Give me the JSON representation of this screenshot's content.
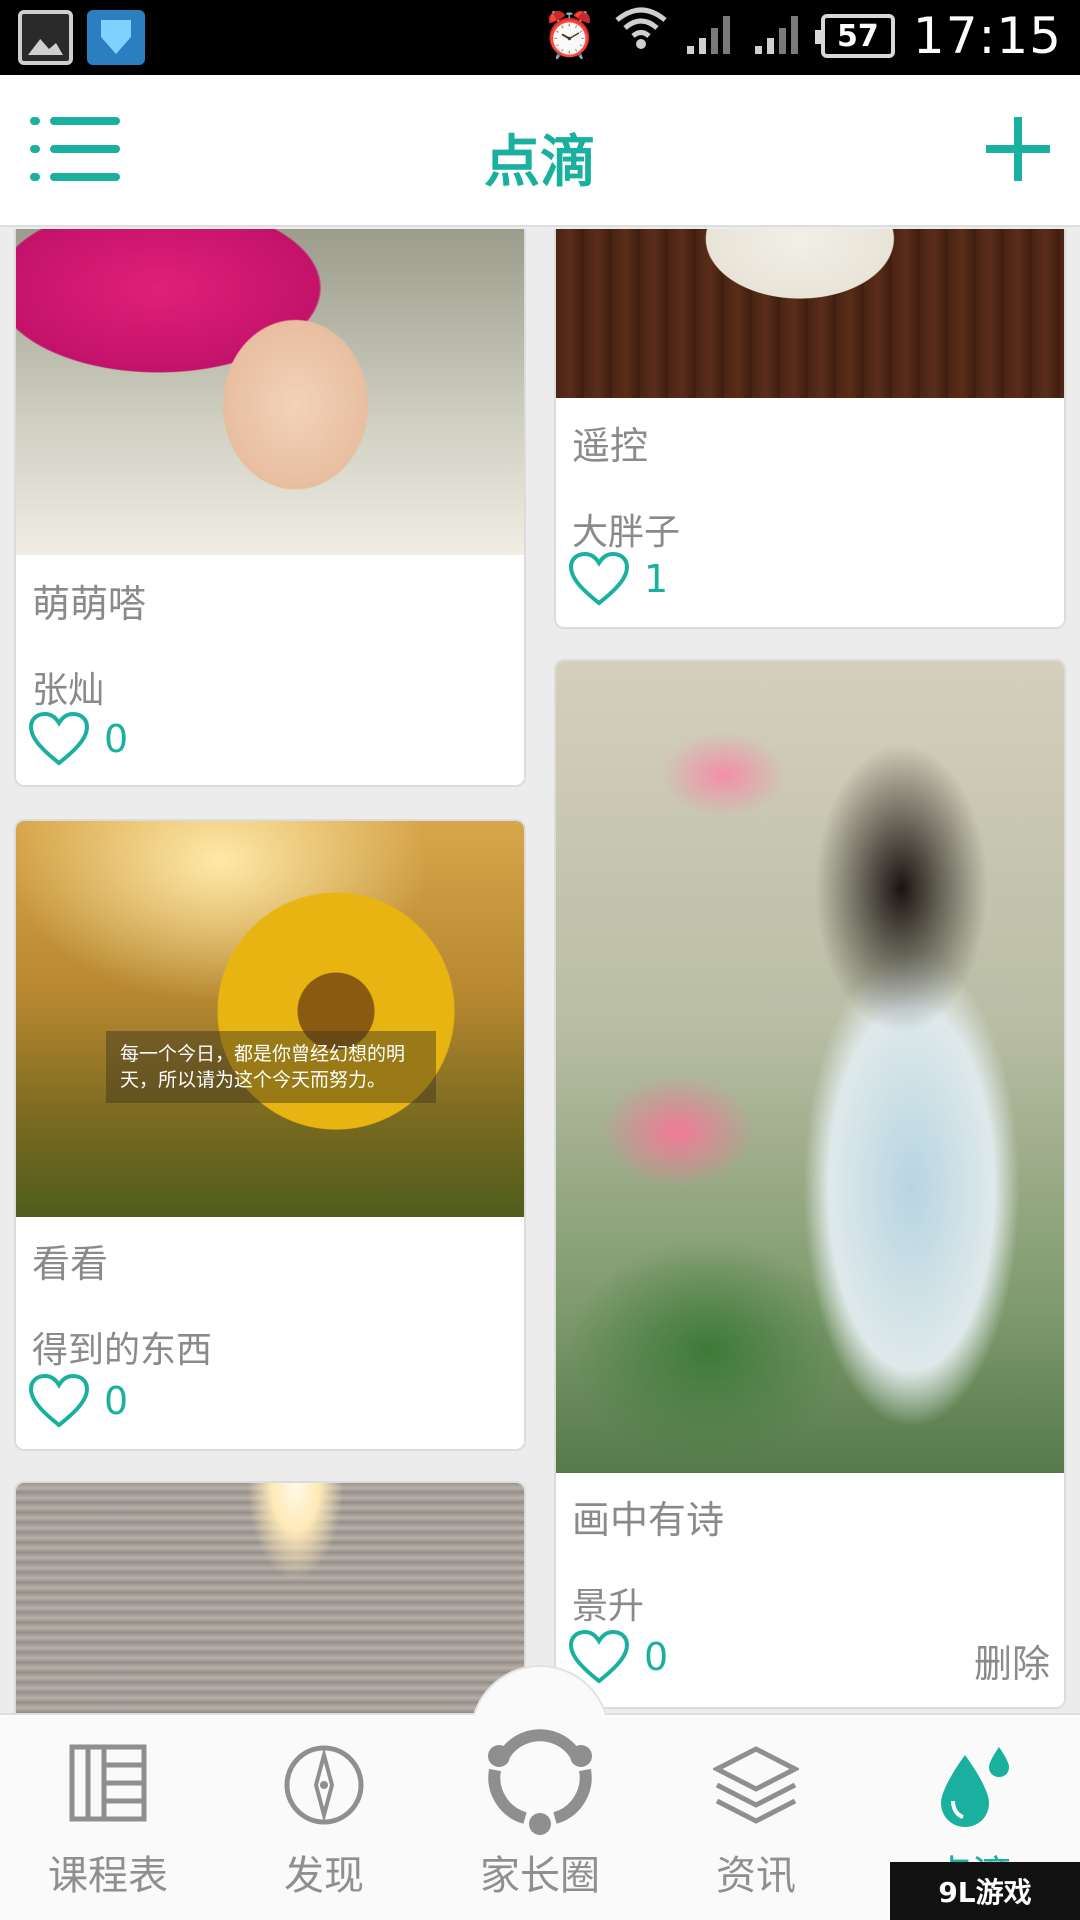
{
  "status_bar": {
    "battery": "57",
    "time": "17:15"
  },
  "header": {
    "title": "点滴"
  },
  "cards": [
    {
      "title": "萌萌嗒",
      "author": "张灿",
      "likes": "0"
    },
    {
      "title": "遥控",
      "author": "大胖子",
      "likes": "1"
    },
    {
      "title": "看看",
      "author": "得到的东西",
      "likes": "0",
      "image_text": "每一个今日，都是你曾经幻想的明天，所以请为这个今天而努力。"
    },
    {
      "title": "画中有诗",
      "author": "景升",
      "likes": "0",
      "delete_label": "删除"
    }
  ],
  "nav": [
    {
      "label": "课程表",
      "icon": "schedule-icon"
    },
    {
      "label": "发现",
      "icon": "compass-icon"
    },
    {
      "label": "家长圈",
      "icon": "parents-circle-icon"
    },
    {
      "label": "资讯",
      "icon": "layers-icon"
    },
    {
      "label": "点滴",
      "icon": "droplet-icon",
      "active": true
    }
  ],
  "watermark": "9L游戏",
  "colors": {
    "accent": "#1ab0a0",
    "text": "#8a8a8a"
  }
}
